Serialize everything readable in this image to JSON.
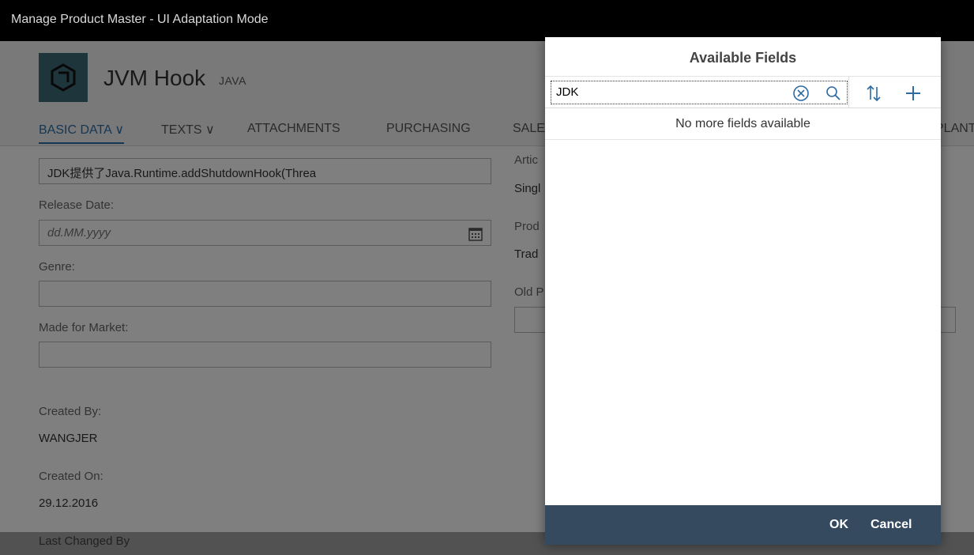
{
  "shell": {
    "title": "Manage Product Master  - UI Adaptation Mode"
  },
  "object": {
    "title": "JVM Hook",
    "subtitle": "JAVA"
  },
  "tabs": [
    {
      "label": "BASIC DATA ∨"
    },
    {
      "label": "TEXTS ∨"
    },
    {
      "label": "ATTACHMENTS"
    },
    {
      "label": "PURCHASING"
    },
    {
      "label": "SALE"
    },
    {
      "label": "PLANT"
    }
  ],
  "form_left": {
    "product_field_value": "JDK提供了Java.Runtime.addShutdownHook(Threa",
    "release_date_label": "Release Date:",
    "release_date_placeholder": "dd.MM.yyyy",
    "genre_label": "Genre:",
    "market_label": "Made for Market:",
    "created_by_label": "Created By:",
    "created_by_value": "WANGJER",
    "created_on_label": "Created On:",
    "created_on_value": "29.12.2016",
    "last_changed_label": "Last Changed By"
  },
  "form_right": {
    "artic_label": "Artic",
    "sing_value": "Singl",
    "prod_label": "Prod",
    "trad_value": "Trad",
    "old_label": "Old P"
  },
  "dialog": {
    "title": "Available Fields",
    "search_value": "JDK",
    "empty_text": "No more fields available",
    "ok_label": "OK",
    "cancel_label": "Cancel"
  }
}
